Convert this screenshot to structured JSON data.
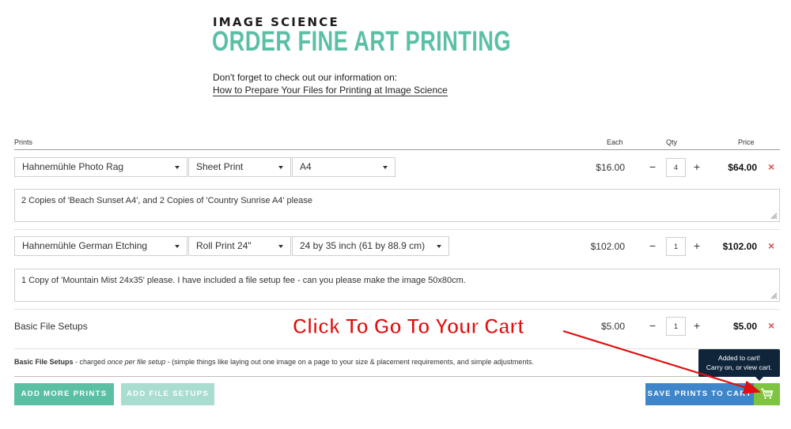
{
  "header": {
    "brand": "IMAGE SCIENCE",
    "title": "ORDER FINE ART PRINTING",
    "intro": "Don't forget to check out our information on:",
    "link": "How to Prepare Your Files for Printing at Image Science"
  },
  "table": {
    "headers": {
      "prints": "Prints",
      "each": "Each",
      "qty": "Qty",
      "price": "Price"
    }
  },
  "rows": [
    {
      "paper": "Hahnemühle Photo Rag",
      "type": "Sheet Print",
      "size": "A4",
      "each": "$16.00",
      "qty": "4",
      "price": "$64.00",
      "note": "2 Copies of 'Beach Sunset A4', and 2 Copies of 'Country Sunrise A4' please"
    },
    {
      "paper": "Hahnemühle German Etching",
      "type": "Roll Print 24\"",
      "size": "24 by 35 inch (61 by 88.9 cm)",
      "each": "$102.00",
      "qty": "1",
      "price": "$102.00",
      "note": "1 Copy of 'Mountain Mist 24x35' please. I have included a file setup fee - can you please make the image 50x80cm."
    }
  ],
  "setup": {
    "label": "Basic File Setups",
    "each": "$5.00",
    "qty": "1",
    "price": "$5.00"
  },
  "footnote": {
    "bold": "Basic File Setups",
    "a": " - charged ",
    "italic": "once per file setup",
    "b": " - (simple things like laying out one image on a page to your size & placement requirements, and simple adjustments."
  },
  "controls": {
    "minus": "−",
    "plus": "+",
    "remove": "×"
  },
  "buttons": {
    "add_prints": "ADD MORE PRINTS",
    "add_setups": "ADD FILE SETUPS",
    "save": "SAVE PRINTS TO CART"
  },
  "tooltip": {
    "line1": "Added to cart!",
    "line2": "Carry on, or view cart."
  },
  "annotation": "Click To Go To Your Cart",
  "colors": {
    "accent": "#5bbfa6",
    "save": "#3f85c9",
    "cart": "#7dc540",
    "annotation": "#e10f0f",
    "remove": "#d9534f"
  }
}
